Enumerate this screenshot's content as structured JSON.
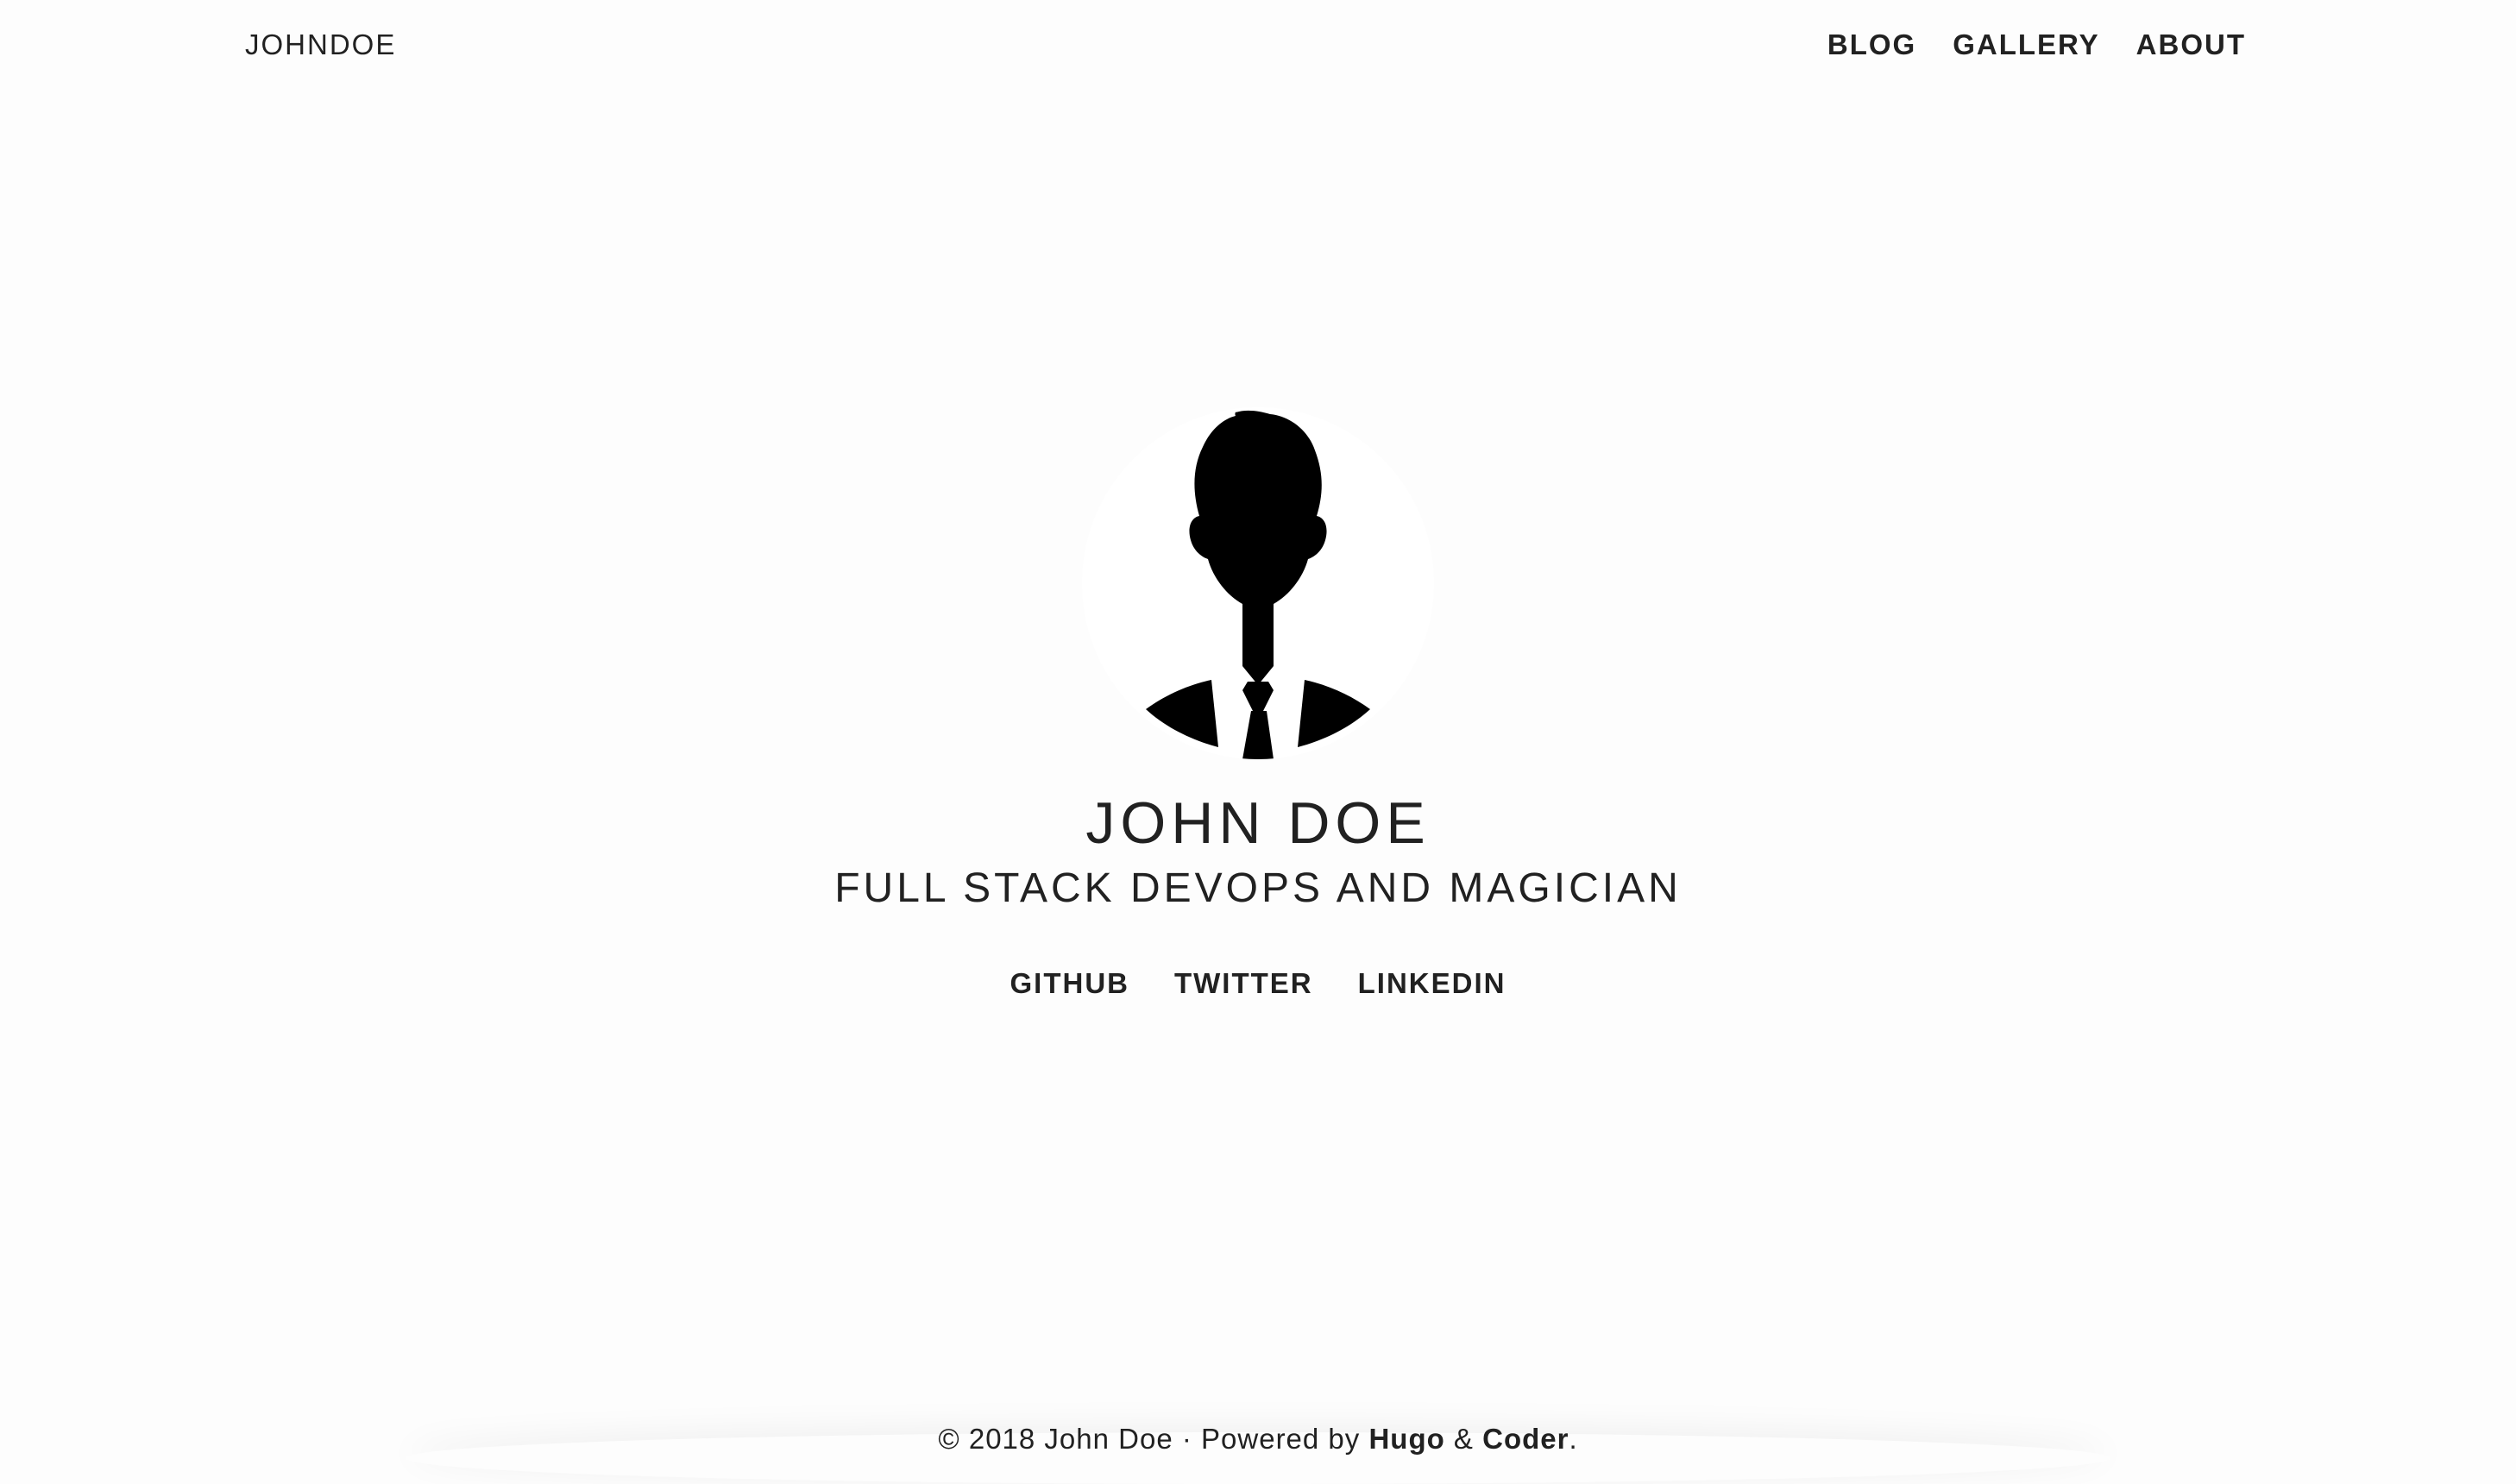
{
  "brand": "JOHNDOE",
  "nav": {
    "items": [
      "BLOG",
      "GALLERY",
      "ABOUT"
    ]
  },
  "profile": {
    "avatar_icon": "person-silhouette-icon",
    "name": "JOHN DOE",
    "tagline": "FULL STACK DEVOPS AND MAGICIAN"
  },
  "social": {
    "links": [
      "GITHUB",
      "TWITTER",
      "LINKEDIN"
    ]
  },
  "footer": {
    "prefix": "© 2018 John Doe · Powered by ",
    "hugo": "Hugo",
    "amp": " & ",
    "coder": "Coder",
    "suffix": "."
  },
  "colors": {
    "background": "#fdfdfd",
    "text": "#212121"
  }
}
